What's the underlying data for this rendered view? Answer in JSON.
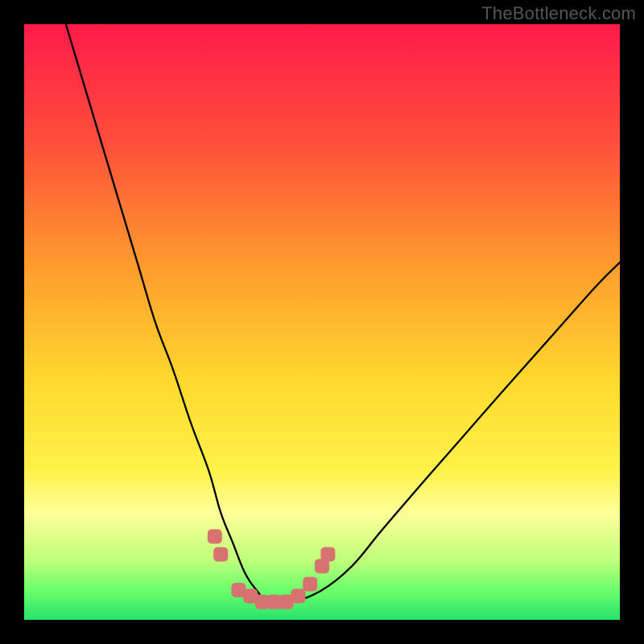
{
  "watermark": "TheBottleneck.com",
  "chart_data": {
    "type": "line",
    "title": "",
    "xlabel": "",
    "ylabel": "",
    "xlim": [
      0,
      100
    ],
    "ylim": [
      0,
      100
    ],
    "grid": false,
    "legend": false,
    "gradient_stops": [
      {
        "offset": 0.0,
        "color": "#ff1a4b"
      },
      {
        "offset": 0.2,
        "color": "#ff4f3a"
      },
      {
        "offset": 0.4,
        "color": "#ff9a2e"
      },
      {
        "offset": 0.6,
        "color": "#ffd92e"
      },
      {
        "offset": 0.75,
        "color": "#fff24a"
      },
      {
        "offset": 0.82,
        "color": "#ffff99"
      },
      {
        "offset": 0.9,
        "color": "#bfff7a"
      },
      {
        "offset": 0.95,
        "color": "#6cff6c"
      },
      {
        "offset": 1.0,
        "color": "#27e36a"
      }
    ],
    "series": [
      {
        "name": "bottleneck-curve",
        "color": "#000000",
        "x": [
          7,
          10,
          13,
          16,
          19,
          22,
          25,
          28,
          31,
          33,
          35,
          37,
          39,
          41,
          45,
          50,
          55,
          60,
          66,
          73,
          80,
          88,
          96,
          100
        ],
        "y": [
          100,
          90,
          80,
          70,
          60,
          50,
          42,
          33,
          25,
          18,
          13,
          8,
          5,
          3,
          3,
          5,
          9,
          15,
          22,
          30,
          38,
          47,
          56,
          60
        ]
      }
    ],
    "markers": {
      "name": "optimum-markers",
      "color": "#d6726f",
      "shape": "rounded-square",
      "size": 18,
      "points": [
        {
          "x": 32,
          "y": 14
        },
        {
          "x": 33,
          "y": 11
        },
        {
          "x": 36,
          "y": 5
        },
        {
          "x": 38,
          "y": 4
        },
        {
          "x": 40,
          "y": 3
        },
        {
          "x": 42,
          "y": 3
        },
        {
          "x": 44,
          "y": 3
        },
        {
          "x": 46,
          "y": 4
        },
        {
          "x": 48,
          "y": 6
        },
        {
          "x": 50,
          "y": 9
        },
        {
          "x": 51,
          "y": 11
        }
      ]
    }
  }
}
